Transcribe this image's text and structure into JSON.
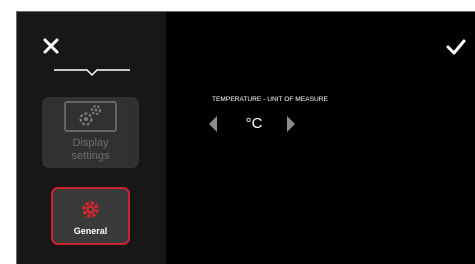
{
  "sidebar": {
    "close_icon": "close-x-icon",
    "tiles": [
      {
        "label": "Display\nsettings",
        "icon": "display-settings-gear-icon",
        "state": "disabled"
      },
      {
        "label": "General",
        "icon": "general-gear-icon",
        "state": "selected"
      }
    ]
  },
  "main": {
    "confirm_icon": "checkmark-icon",
    "setting": {
      "label": "TEMPERATURE - UNIT OF MEASURE",
      "value": "°C",
      "prev_icon": "arrow-left-icon",
      "next_icon": "arrow-right-icon"
    }
  },
  "colors": {
    "background": "#000000",
    "sidebar": "#171717",
    "tile": "#3a3a3a",
    "accent": "#c8252f",
    "text": "#ffffff",
    "arrow": "#8c8c8c"
  }
}
